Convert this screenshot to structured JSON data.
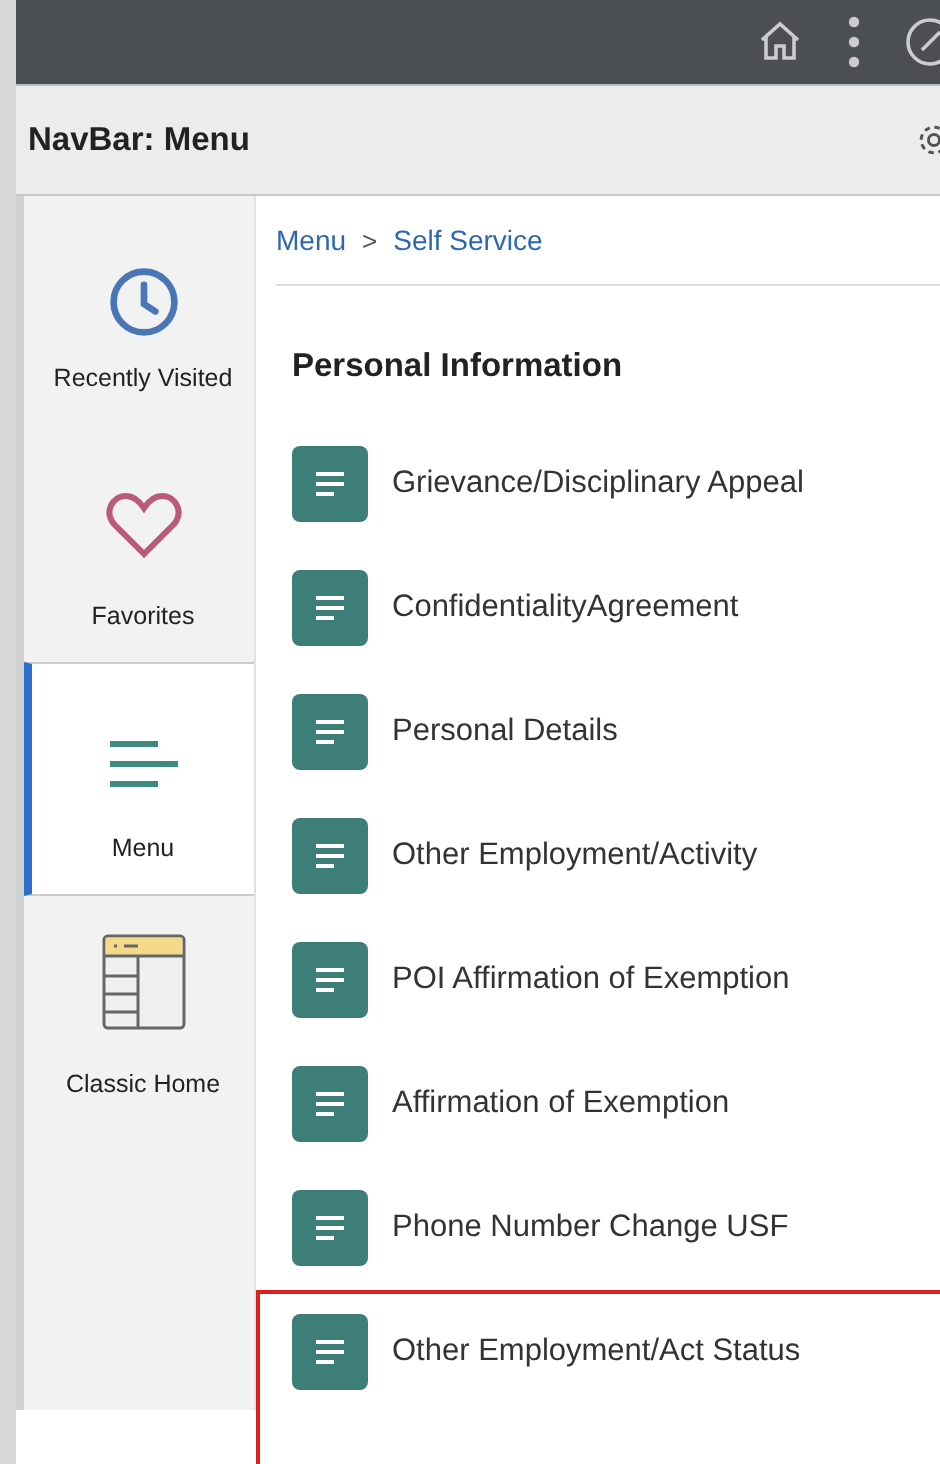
{
  "header": {
    "title": "NavBar: Menu"
  },
  "sidebar": {
    "items": [
      {
        "kind": "clock",
        "label": "Recently Visited",
        "selected": false
      },
      {
        "kind": "heart",
        "label": "Favorites",
        "selected": false
      },
      {
        "kind": "menu",
        "label": "Menu",
        "selected": true
      },
      {
        "kind": "classic",
        "label": "Classic Home",
        "selected": false
      }
    ]
  },
  "breadcrumb": {
    "items": [
      "Menu",
      "Self Service"
    ],
    "separator": ">"
  },
  "section": {
    "title": "Personal Information",
    "items": [
      {
        "label": "Grievance/Disciplinary Appeal",
        "highlighted": false
      },
      {
        "label": "ConfidentialityAgreement",
        "highlighted": false
      },
      {
        "label": "Personal Details",
        "highlighted": false
      },
      {
        "label": "Other Employment/Activity",
        "highlighted": false
      },
      {
        "label": "POI Affirmation of Exemption",
        "highlighted": false
      },
      {
        "label": "Affirmation of Exemption",
        "highlighted": false
      },
      {
        "label": "Phone Number Change USF",
        "highlighted": false
      },
      {
        "label": "Other Employment/Act Status",
        "highlighted": true
      }
    ]
  }
}
